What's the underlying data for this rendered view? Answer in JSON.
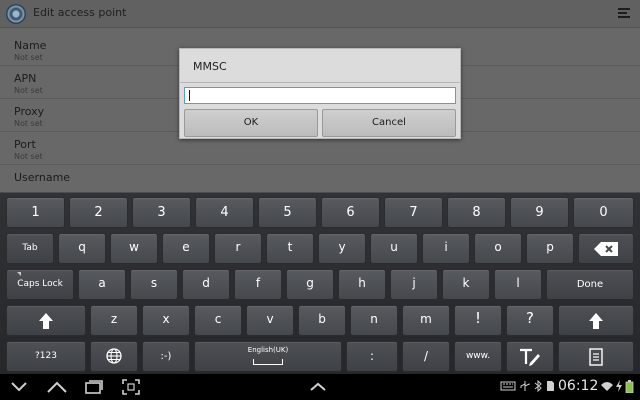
{
  "actionbar": {
    "title": "Edit access point",
    "menu_icon": "overflow-menu-icon"
  },
  "preferences": [
    {
      "title": "Name",
      "summary": "Not set"
    },
    {
      "title": "APN",
      "summary": "Not set"
    },
    {
      "title": "Proxy",
      "summary": "Not set"
    },
    {
      "title": "Port",
      "summary": "Not set"
    },
    {
      "title": "Username",
      "summary": ""
    }
  ],
  "dialog": {
    "title": "MMSC",
    "input_value": "",
    "ok_label": "OK",
    "cancel_label": "Cancel"
  },
  "keyboard": {
    "numbers": [
      "1",
      "2",
      "3",
      "4",
      "5",
      "6",
      "7",
      "8",
      "9",
      "0"
    ],
    "row_q": [
      "q",
      "w",
      "e",
      "r",
      "t",
      "y",
      "u",
      "i",
      "o",
      "p"
    ],
    "row_a": [
      "a",
      "s",
      "d",
      "f",
      "g",
      "h",
      "j",
      "k",
      "l"
    ],
    "row_z": [
      "z",
      "x",
      "c",
      "v",
      "b",
      "n",
      "m"
    ],
    "punct": [
      "!",
      "?"
    ],
    "tab_label": "Tab",
    "caps_label": "Caps Lock",
    "done_label": "Done",
    "sym_label": "?123",
    "smiley_label": ":-)",
    "space_label": "English(UK)",
    "colon_label": ":",
    "slash_label": "/",
    "www_label": "www."
  },
  "status": {
    "time": "06:12"
  },
  "colors": {
    "input_focus": "#5c9dd0",
    "key_top": "#575a5f",
    "key_bottom": "#45484d"
  }
}
